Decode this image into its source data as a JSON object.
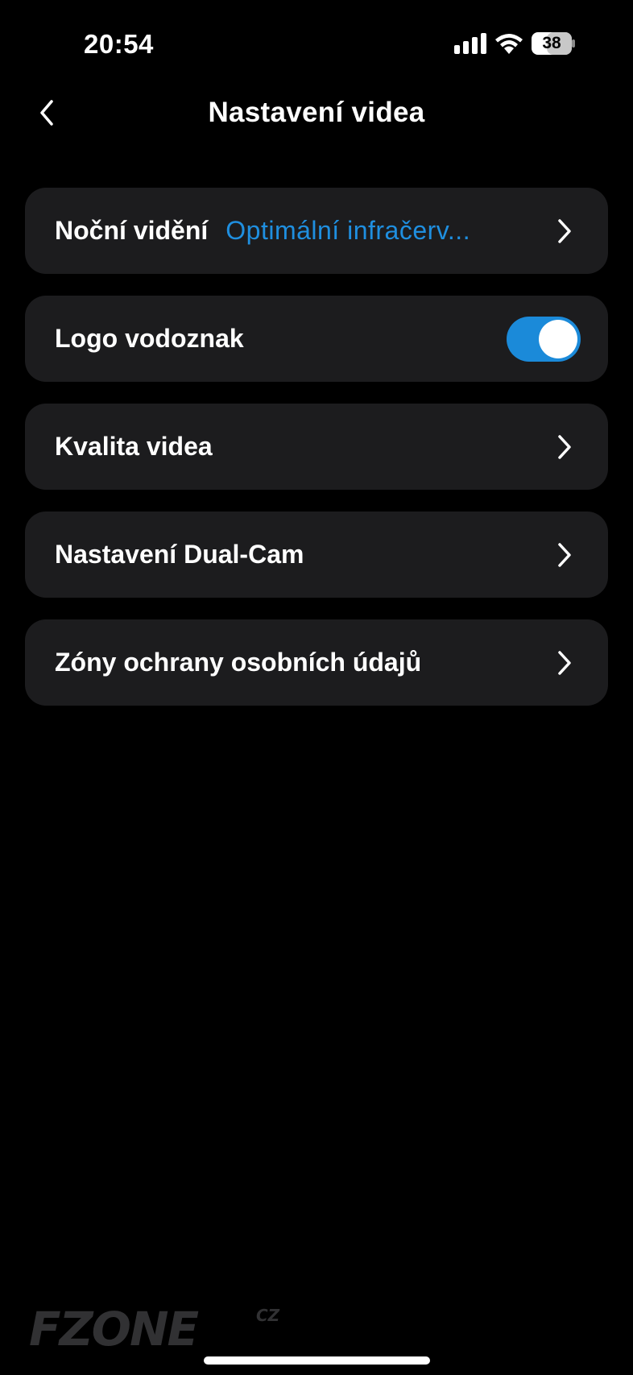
{
  "status_bar": {
    "time": "20:54",
    "battery": "38",
    "icons": [
      "signal-icon",
      "wifi-icon",
      "battery-icon"
    ]
  },
  "nav": {
    "title": "Nastavení videa",
    "back_icon": "chevron-left-icon"
  },
  "settings": {
    "night_vision": {
      "label": "Noční vidění",
      "value": "Optimální infračerv..."
    },
    "logo_watermark": {
      "label": "Logo vodoznak",
      "enabled": true
    },
    "video_quality": {
      "label": "Kvalita videa"
    },
    "dual_cam": {
      "label": "Nastavení Dual-Cam"
    },
    "privacy_zones": {
      "label": "Zóny ochrany osobních údajů"
    }
  },
  "watermark": {
    "text": "FZONE",
    "suffix": "CZ"
  },
  "colors": {
    "background": "#000000",
    "row_background": "#1c1c1e",
    "accent": "#1f8fe0",
    "toggle_on": "#1b8ad9",
    "text": "#ffffff"
  }
}
